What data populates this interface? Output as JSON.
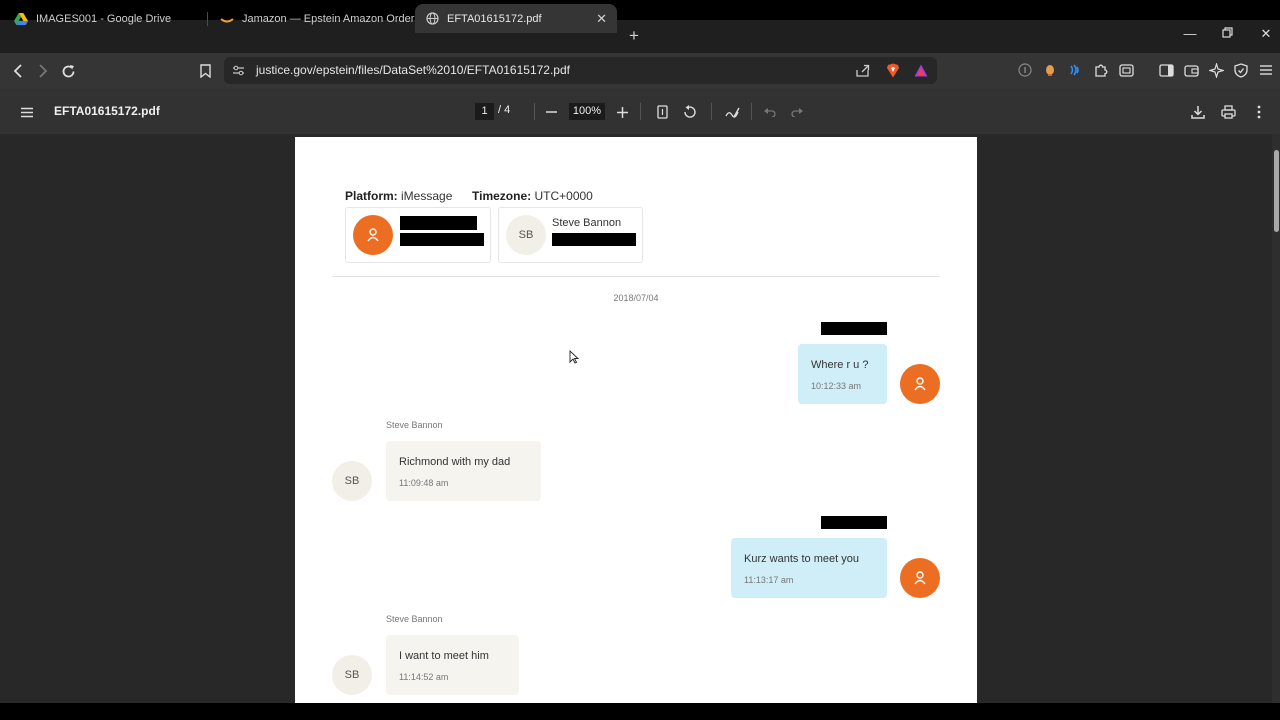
{
  "tabs": [
    {
      "title": "IMAGES001 - Google Drive",
      "icon": "google-drive-icon"
    },
    {
      "title": "Jamazon — Epstein Amazon Orders",
      "icon": "amazon-icon"
    },
    {
      "title": "EFTA01615172.pdf",
      "icon": "globe-icon",
      "close": "✕"
    }
  ],
  "address_bar": {
    "url": "justice.gov/epstein/files/DataSet%2010/EFTA01615172.pdf"
  },
  "pdf_toolbar": {
    "title": "EFTA01615172.pdf",
    "page_current": "1",
    "page_total": "/  4",
    "zoom": "100%"
  },
  "document": {
    "platform_label": "Platform:",
    "platform_value": "iMessage",
    "timezone_label": "Timezone:",
    "timezone_value": "UTC+0000",
    "participant_initials": "SB",
    "participant_name": "Steve Bannon",
    "date": "2018/07/04",
    "messages": [
      {
        "direction": "out",
        "text": "Where r u ?",
        "time": "10:12:33 am"
      },
      {
        "direction": "in",
        "sender": "Steve Bannon",
        "initials": "SB",
        "text": "Richmond with my dad",
        "time": "11:09:48 am"
      },
      {
        "direction": "out",
        "text": "Kurz wants to meet you",
        "time": "11:13:17 am"
      },
      {
        "direction": "in",
        "sender": "Steve Bannon",
        "initials": "SB",
        "text": "I want to meet him",
        "time": "11:14:52 am"
      }
    ]
  },
  "colors": {
    "avatar_orange": "#ec6e22",
    "outgoing_bubble": "#cfeef7",
    "incoming_bubble": "#f5f4ef",
    "viewer_bg": "#282828"
  }
}
